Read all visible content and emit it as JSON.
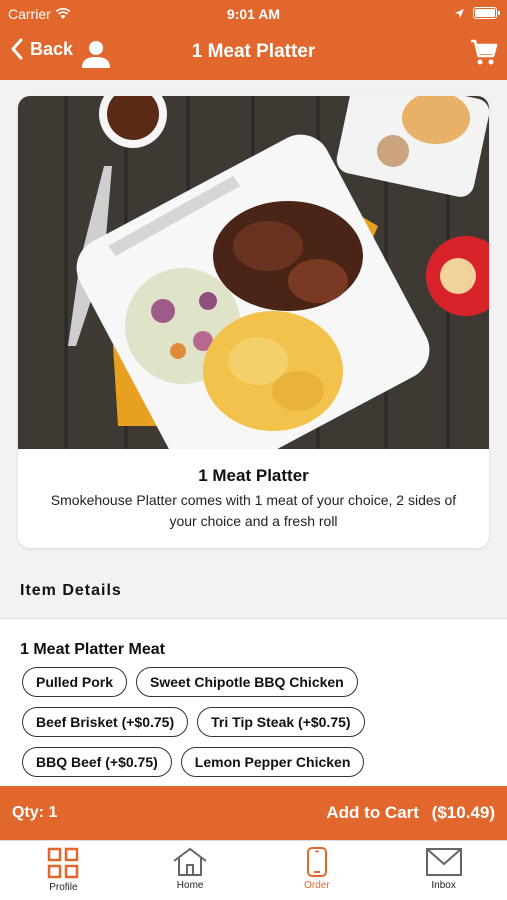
{
  "status": {
    "carrier": "Carrier",
    "time": "9:01 AM"
  },
  "nav": {
    "back_label": "Back",
    "title": "1 Meat Platter"
  },
  "item": {
    "title": "1 Meat Platter",
    "description": "Smokehouse Platter comes with 1 meat of your choice, 2 sides of your choice and a fresh roll"
  },
  "details": {
    "section_title": "Item Details"
  },
  "options": {
    "title": "1 Meat Platter Meat",
    "choices": [
      "Pulled Pork",
      "Sweet Chipotle BBQ Chicken",
      "Beef Brisket (+$0.75)",
      "Tri Tip Steak (+$0.75)",
      "BBQ Beef (+$0.75)",
      "Lemon Pepper Chicken"
    ]
  },
  "cart": {
    "qty_label": "Qty: 1",
    "add_label": "Add to Cart",
    "price": "($10.49)"
  },
  "tabs": [
    {
      "label": "Profile",
      "icon": "qr-code-icon"
    },
    {
      "label": "Home",
      "icon": "home-icon"
    },
    {
      "label": "Order",
      "icon": "phone-icon"
    },
    {
      "label": "Inbox",
      "icon": "mail-icon"
    }
  ],
  "colors": {
    "accent": "#e2672d",
    "active_tab": "#e2672d"
  }
}
